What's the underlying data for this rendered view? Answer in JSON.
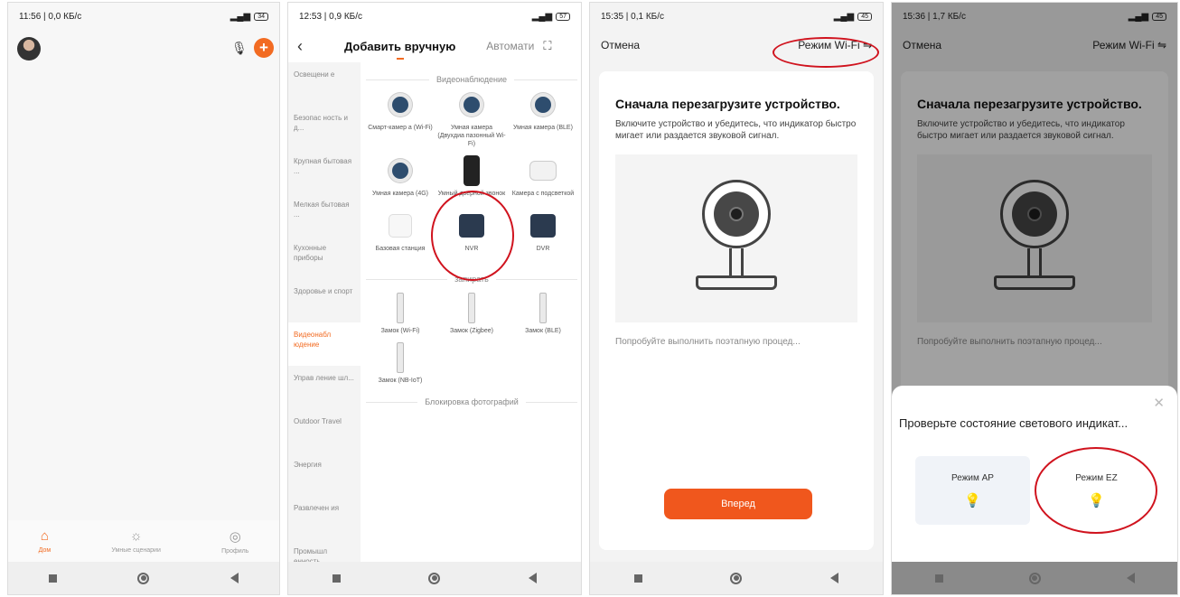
{
  "screen1": {
    "status_time": "11:56 | 0,0 КБ/с",
    "battery": "34",
    "tabs": [
      {
        "label": "Дом",
        "icon": "home-icon"
      },
      {
        "label": "Умные сценарии",
        "icon": "sun-icon"
      },
      {
        "label": "Профиль",
        "icon": "profile-icon"
      }
    ]
  },
  "screen2": {
    "status_time": "12:53 | 0,9 КБ/с",
    "battery": "57",
    "title": "Добавить вручную",
    "auto": "Автомати",
    "sidebar": [
      "Освещени е",
      "Безопас ность и д...",
      "Крупная бытовая ...",
      "Мелкая бытовая ...",
      "Кухонные приборы",
      "Здоровье и спорт",
      "Видеонабл юдение",
      "Управ ление шл...",
      "Outdoor Travel",
      "Энергия",
      "Развлечен ия",
      "Промышл енность ..."
    ],
    "section_video": "Видеонаблюдение",
    "devices_row1": [
      "Смарт-камер а (Wi-Fi)",
      "Умная камера (Двухдиа пазонный Wi-Fi)",
      "Умная камера (BLE)"
    ],
    "devices_row2": [
      "Умная камера (4G)",
      "Умный дверной звонок",
      "Камера с подсветкой"
    ],
    "devices_row3": [
      "Базовая станция",
      "NVR",
      "DVR"
    ],
    "section_lock": "запирать",
    "locks_row1": [
      "Замок (Wi-Fi)",
      "Замок (Zigbee)",
      "Замок (BLE)"
    ],
    "locks_row2": [
      "Замок (NB-IoT)"
    ],
    "section_photo": "Блокировка фотографий"
  },
  "screen3": {
    "status_time": "15:35 | 0,1 КБ/с",
    "battery": "45",
    "cancel": "Отмена",
    "mode": "Режим Wi-Fi ⇋",
    "heading": "Сначала перезагрузите устройство.",
    "body": "Включите устройство и убедитесь, что индикатор быстро мигает или раздается звуковой сигнал.",
    "link": "Попробуйте выполнить поэтапную процед...",
    "button": "Вперед"
  },
  "screen4": {
    "status_time": "15:36 | 1,7 КБ/с",
    "battery": "45",
    "cancel": "Отмена",
    "mode": "Режим Wi-Fi ⇋",
    "heading": "Сначала перезагрузите устройство.",
    "body": "Включите устройство и убедитесь, что индикатор быстро мигает или раздается звуковой сигнал.",
    "link": "Попробуйте выполнить поэтапную процед...",
    "sheet_title": "Проверьте состояние светового индикат...",
    "mode_ap": "Режим AP",
    "mode_ez": "Режим EZ"
  }
}
